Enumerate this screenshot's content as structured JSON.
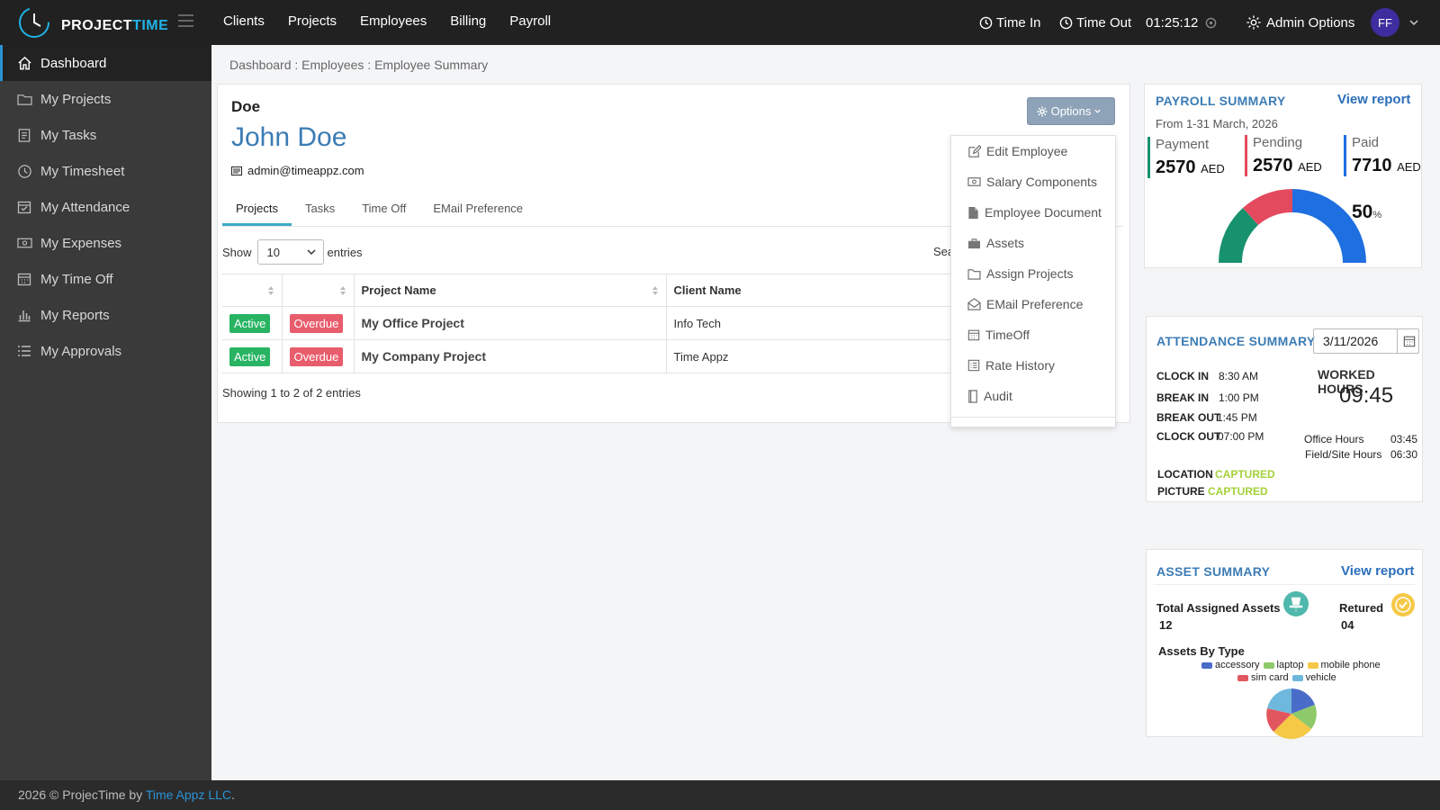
{
  "app": {
    "logo_main": "PROJECT",
    "logo_accent": "IME",
    "logo_t": "T"
  },
  "topnav": [
    "Clients",
    "Projects",
    "Employees",
    "Billing",
    "Payroll"
  ],
  "topbar": {
    "time_in": "Time In",
    "time_out": "Time Out",
    "timer": "01:25:12",
    "admin": "Admin Options",
    "avatar": "FF"
  },
  "sidebar": [
    {
      "label": "Dashboard",
      "icon": "home-icon",
      "active": true
    },
    {
      "label": "My Projects",
      "icon": "folder-icon"
    },
    {
      "label": "My Tasks",
      "icon": "tasks-icon"
    },
    {
      "label": "My Timesheet",
      "icon": "clock-icon"
    },
    {
      "label": "My Attendance",
      "icon": "calendar-check-icon"
    },
    {
      "label": "My Expenses",
      "icon": "money-icon"
    },
    {
      "label": "My Time Off",
      "icon": "calendar-icon"
    },
    {
      "label": "My Reports",
      "icon": "bar-chart-icon"
    },
    {
      "label": "My Approvals",
      "icon": "list-icon"
    }
  ],
  "breadcrumb": "Dashboard : Employees : Employee Summary",
  "employee": {
    "short": "Doe",
    "name": "John Doe",
    "email": "admin@timeappz.com"
  },
  "tabs": [
    "Projects",
    "Tasks",
    "Time Off",
    "EMail Preference"
  ],
  "options_label": "Options",
  "table": {
    "show": "Show",
    "entries_value": "10",
    "entries": "entries",
    "search": "Sea",
    "headers": [
      "",
      "",
      "Project Name",
      "Client Name"
    ],
    "rows": [
      {
        "status": "Active",
        "due": "Overdue",
        "project": "My Office Project",
        "client": "Info Tech"
      },
      {
        "status": "Active",
        "due": "Overdue",
        "project": "My Company Project",
        "client": "Time Appz"
      }
    ],
    "showing": "Showing 1 to 2 of 2 entries"
  },
  "dropdown": [
    {
      "label": "Edit Employee",
      "icon": "edit-icon"
    },
    {
      "label": "Salary Components",
      "icon": "money-icon"
    },
    {
      "label": "Employee Document",
      "icon": "document-icon"
    },
    {
      "label": "Assets",
      "icon": "briefcase-icon"
    },
    {
      "label": "Assign Projects",
      "icon": "folder-icon"
    },
    {
      "label": "EMail Preference",
      "icon": "envelope-open-icon"
    },
    {
      "label": "TimeOff",
      "icon": "calendar-icon"
    },
    {
      "label": "Rate History",
      "icon": "list-table-icon"
    },
    {
      "label": "Audit",
      "icon": "book-icon"
    }
  ],
  "payroll": {
    "title": "PAYROLL SUMMARY",
    "link": "View report",
    "period": "From 1-31 March, 2026",
    "payment_label": "Payment",
    "payment": "2570",
    "pending_label": "Pending",
    "pending": "2570",
    "paid_label": "Paid",
    "paid": "7710",
    "currency": "AED",
    "percent": "50",
    "percent_sign": "%",
    "colors": {
      "payment": "#17916e",
      "pending": "#e44a5e",
      "paid": "#1e6fe0"
    }
  },
  "attendance": {
    "title": "ATTENDANCE SUMMARY",
    "date": "3/11/2026",
    "clock_in_label": "CLOCK IN",
    "clock_in": "8:30 AM",
    "break_in_label": "BREAK IN",
    "break_in": "1:00 PM",
    "break_out_label": "BREAK OUT",
    "break_out": "1:45 PM",
    "clock_out_label": "CLOCK OUT",
    "clock_out": "07:00 PM",
    "worked_label": "WORKED HOURS",
    "worked": "09:45",
    "office_label": "Office Hours",
    "office": "03:45",
    "field_label": "Field/Site Hours",
    "field": "06:30",
    "location_label": "LOCATION",
    "location": "CAPTURED",
    "picture_label": "PICTURE",
    "picture": "CAPTURED"
  },
  "assets": {
    "title": "ASSET SUMMARY",
    "link": "View report",
    "total_label": "Total Assigned Assets",
    "total": "12",
    "returned_label": "Retured",
    "returned": "04",
    "by_type": "Assets By Type",
    "legend": [
      {
        "name": "accessory",
        "color": "#4a6cc9"
      },
      {
        "name": "laptop",
        "color": "#8ec96a"
      },
      {
        "name": "mobile phone",
        "color": "#f5c846"
      },
      {
        "name": "sim card",
        "color": "#e2565f"
      },
      {
        "name": "vehicle",
        "color": "#6fb8dd"
      }
    ]
  },
  "footer": {
    "text": "2026 © ProjecTime by ",
    "link": "Time Appz LLC",
    "end": "."
  }
}
